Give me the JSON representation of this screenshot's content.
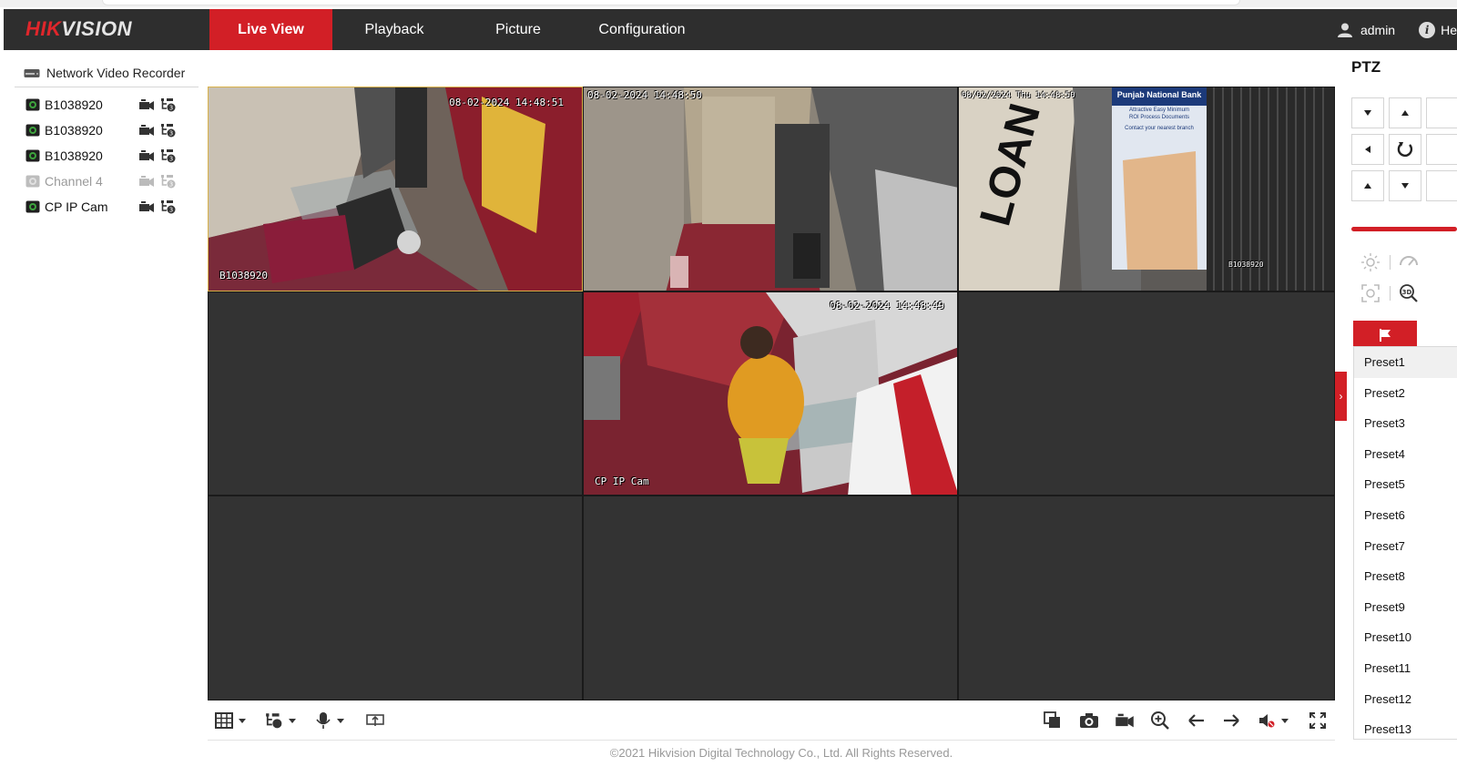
{
  "app": {
    "logo_part1": "HIK",
    "logo_part2": "VISION",
    "tabs": [
      {
        "label": "Live View",
        "active": true
      },
      {
        "label": "Playback",
        "active": false
      },
      {
        "label": "Picture",
        "active": false
      },
      {
        "label": "Configuration",
        "active": false
      }
    ],
    "user": "admin",
    "help": "He",
    "accent_color": "#d21f26"
  },
  "sidebar": {
    "device_title": "Network Video Recorder",
    "channels": [
      {
        "name": "B1038920",
        "enabled": true
      },
      {
        "name": "B1038920",
        "enabled": true
      },
      {
        "name": "B1038920",
        "enabled": true
      },
      {
        "name": "Channel 4",
        "enabled": false
      },
      {
        "name": "CP IP Cam",
        "enabled": true
      }
    ]
  },
  "video": {
    "cells": [
      {
        "timestamp": "08-02-2024 14:48:51",
        "label": "B1038920"
      },
      {
        "timestamp": "08-02-2024 14:48:50",
        "label": ""
      },
      {
        "timestamp": "08/02/2024 Thu 14:48:50",
        "label": "B1038920",
        "sign_title": "Punjab National Bank",
        "sign_line1": "Attractive  Easy  Minimum",
        "sign_line2": "ROI  Process  Documents",
        "sign_line3": "Contact your nearest branch"
      },
      {
        "timestamp": "08-02-2024 14:48:49",
        "label": "CP IP Cam"
      }
    ]
  },
  "footer": {
    "copyright": "©2021 Hikvision Digital Technology Co., Ltd. All Rights Reserved."
  },
  "ptz": {
    "title": "PTZ",
    "presets": [
      "Preset1",
      "Preset2",
      "Preset3",
      "Preset4",
      "Preset5",
      "Preset6",
      "Preset7",
      "Preset8",
      "Preset9",
      "Preset10",
      "Preset11",
      "Preset12",
      "Preset13"
    ]
  }
}
